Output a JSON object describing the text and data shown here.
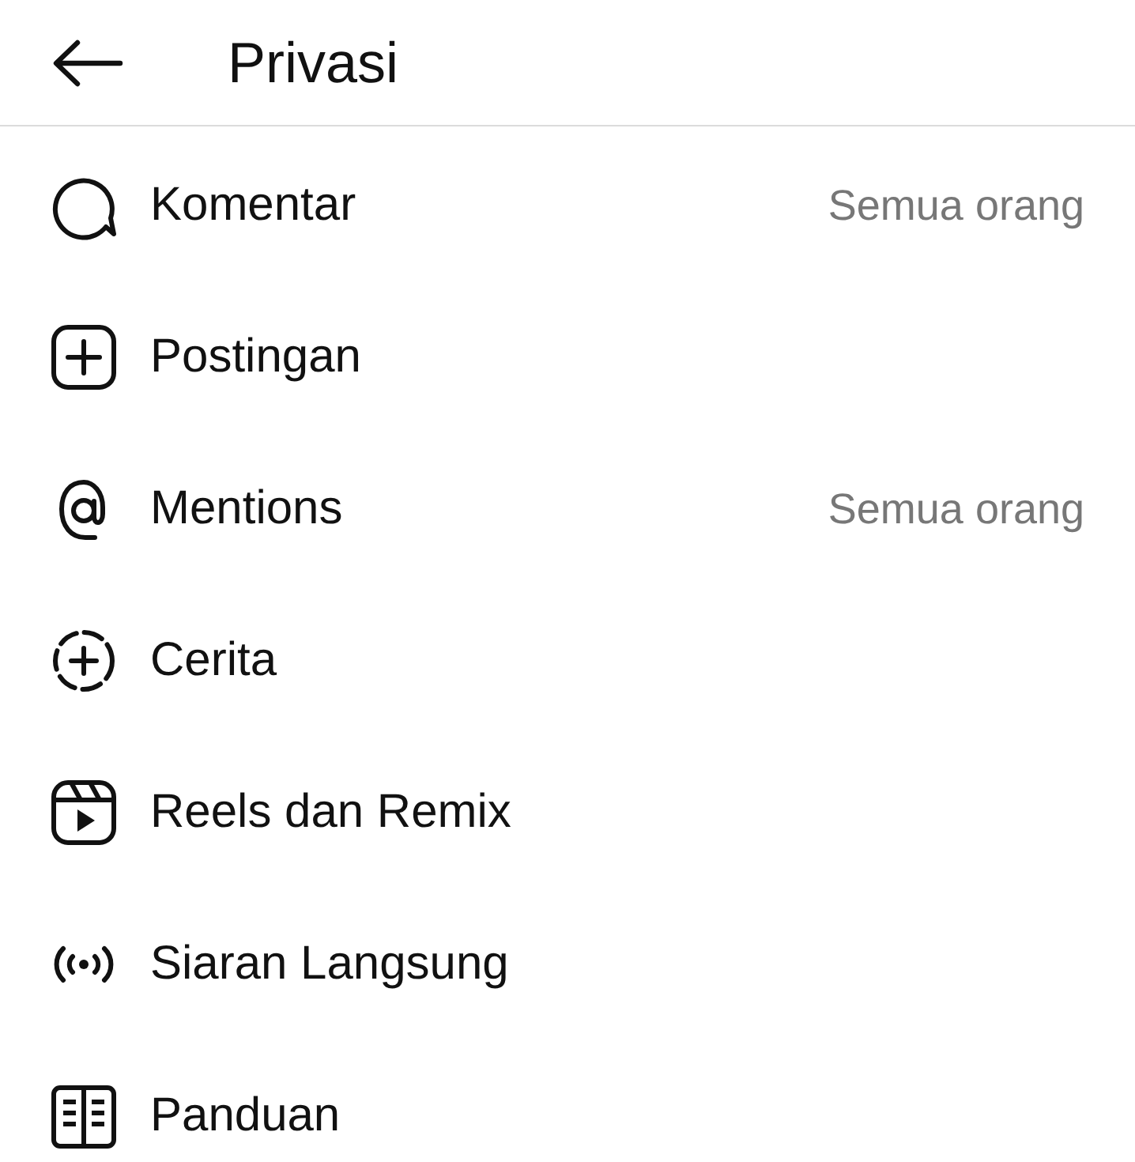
{
  "header": {
    "title": "Privasi"
  },
  "items": [
    {
      "kind": "comment",
      "label": "Komentar",
      "value": "Semua orang"
    },
    {
      "kind": "post",
      "label": "Postingan"
    },
    {
      "kind": "mention",
      "label": "Mentions",
      "value": "Semua orang"
    },
    {
      "kind": "story",
      "label": "Cerita"
    },
    {
      "kind": "reels",
      "label": "Reels dan Remix"
    },
    {
      "kind": "live",
      "label": "Siaran Langsung"
    },
    {
      "kind": "guide",
      "label": "Panduan"
    }
  ]
}
